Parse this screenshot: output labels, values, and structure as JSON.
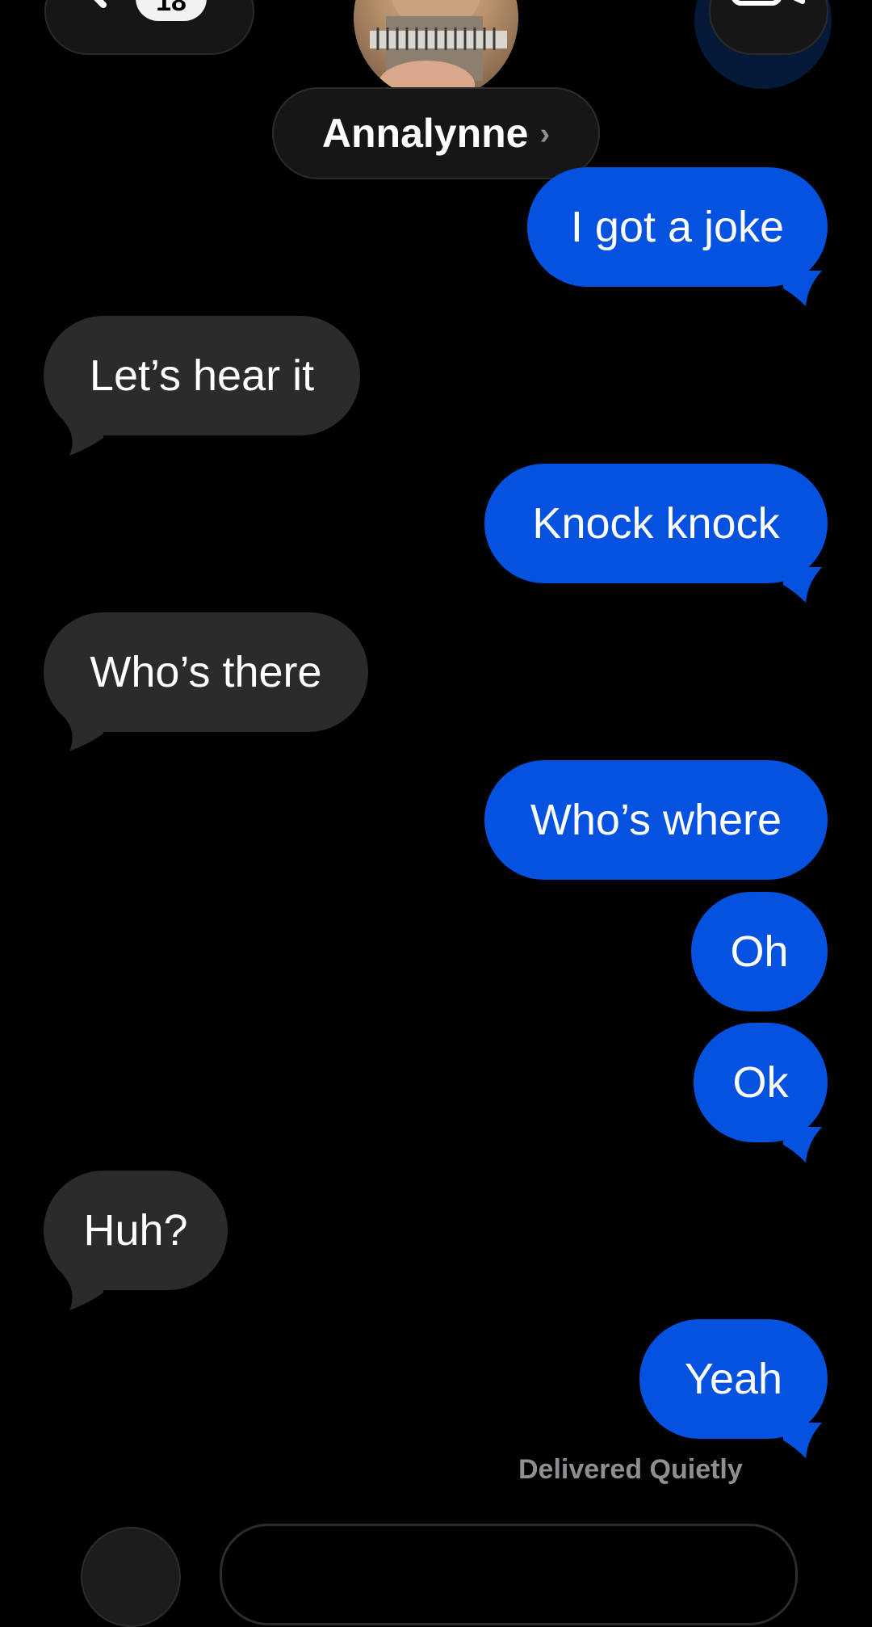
{
  "header": {
    "unread_count": "18",
    "contact_name": "Annalynne",
    "name_chevron": "›"
  },
  "messages": [
    {
      "direction": "outgoing",
      "text": "I got a joke"
    },
    {
      "direction": "incoming",
      "text": "Let’s hear it"
    },
    {
      "direction": "outgoing",
      "text": "Knock knock"
    },
    {
      "direction": "incoming",
      "text": "Who’s there"
    },
    {
      "direction": "outgoing",
      "text": "Who’s where"
    },
    {
      "direction": "outgoing",
      "text": "Oh"
    },
    {
      "direction": "outgoing",
      "text": "Ok"
    },
    {
      "direction": "incoming",
      "text": "Huh?"
    },
    {
      "direction": "outgoing",
      "text": "Yeah"
    }
  ],
  "status_text": "Delivered Quietly",
  "colors": {
    "outgoing_bubble": "#0552e0",
    "incoming_bubble": "#2b2b2d",
    "background": "#000000"
  }
}
